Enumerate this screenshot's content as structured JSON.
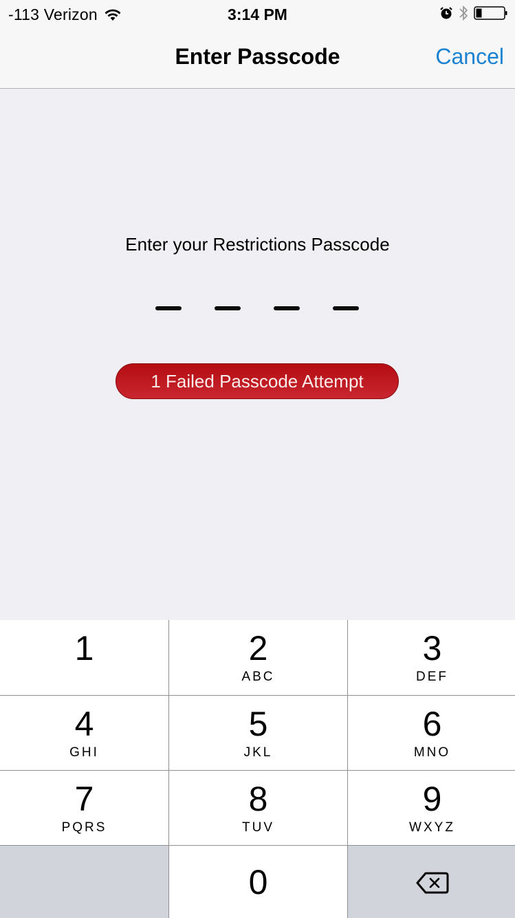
{
  "status_bar": {
    "carrier": "-113 Verizon",
    "time": "3:14 PM",
    "icons": [
      "wifi-icon",
      "alarm-icon",
      "bluetooth-icon",
      "battery-icon"
    ],
    "battery_level": 0.2
  },
  "nav": {
    "title": "Enter Passcode",
    "cancel_label": "Cancel",
    "accent_color": "#1a82d0"
  },
  "main": {
    "prompt": "Enter your Restrictions Passcode",
    "passcode_length": 4,
    "digits_entered": 0,
    "failed_message": "1 Failed Passcode Attempt",
    "failed_color": "#c0141a"
  },
  "keypad": {
    "keys": [
      {
        "digit": "1",
        "letters": ""
      },
      {
        "digit": "2",
        "letters": "ABC"
      },
      {
        "digit": "3",
        "letters": "DEF"
      },
      {
        "digit": "4",
        "letters": "GHI"
      },
      {
        "digit": "5",
        "letters": "JKL"
      },
      {
        "digit": "6",
        "letters": "MNO"
      },
      {
        "digit": "7",
        "letters": "PQRS"
      },
      {
        "digit": "8",
        "letters": "TUV"
      },
      {
        "digit": "9",
        "letters": "WXYZ"
      },
      {
        "digit": "0",
        "letters": ""
      }
    ],
    "delete_icon": "backspace-icon"
  }
}
